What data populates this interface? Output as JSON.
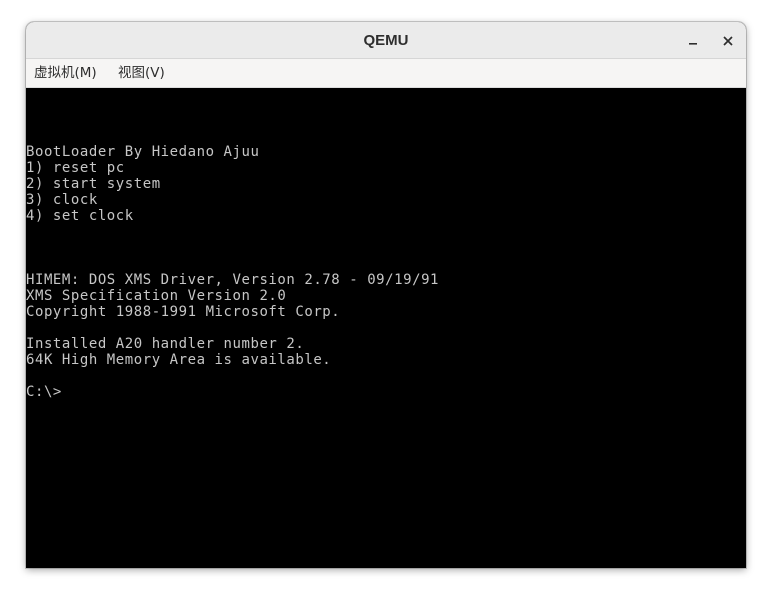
{
  "window": {
    "title": "QEMU",
    "controls": {
      "minimize_icon": "minimize-icon",
      "close_icon": "close-icon"
    }
  },
  "menubar": {
    "items": [
      {
        "label": "虚拟机(M)"
      },
      {
        "label": "视图(V)"
      }
    ]
  },
  "console": {
    "lines": [
      "BootLoader By Hiedano Ajuu",
      "1) reset pc",
      "2) start system",
      "3) clock",
      "4) set clock",
      "",
      "",
      "",
      "HIMEM: DOS XMS Driver, Version 2.78 - 09/19/91",
      "XMS Specification Version 2.0",
      "Copyright 1988-1991 Microsoft Corp.",
      "",
      "Installed A20 handler number 2.",
      "64K High Memory Area is available.",
      "",
      "C:\\>"
    ]
  },
  "colors": {
    "titlebar": "#ebebeb",
    "menubar": "#f6f5f4",
    "screen_bg": "#000000",
    "console_text": "#c6c6c6"
  }
}
